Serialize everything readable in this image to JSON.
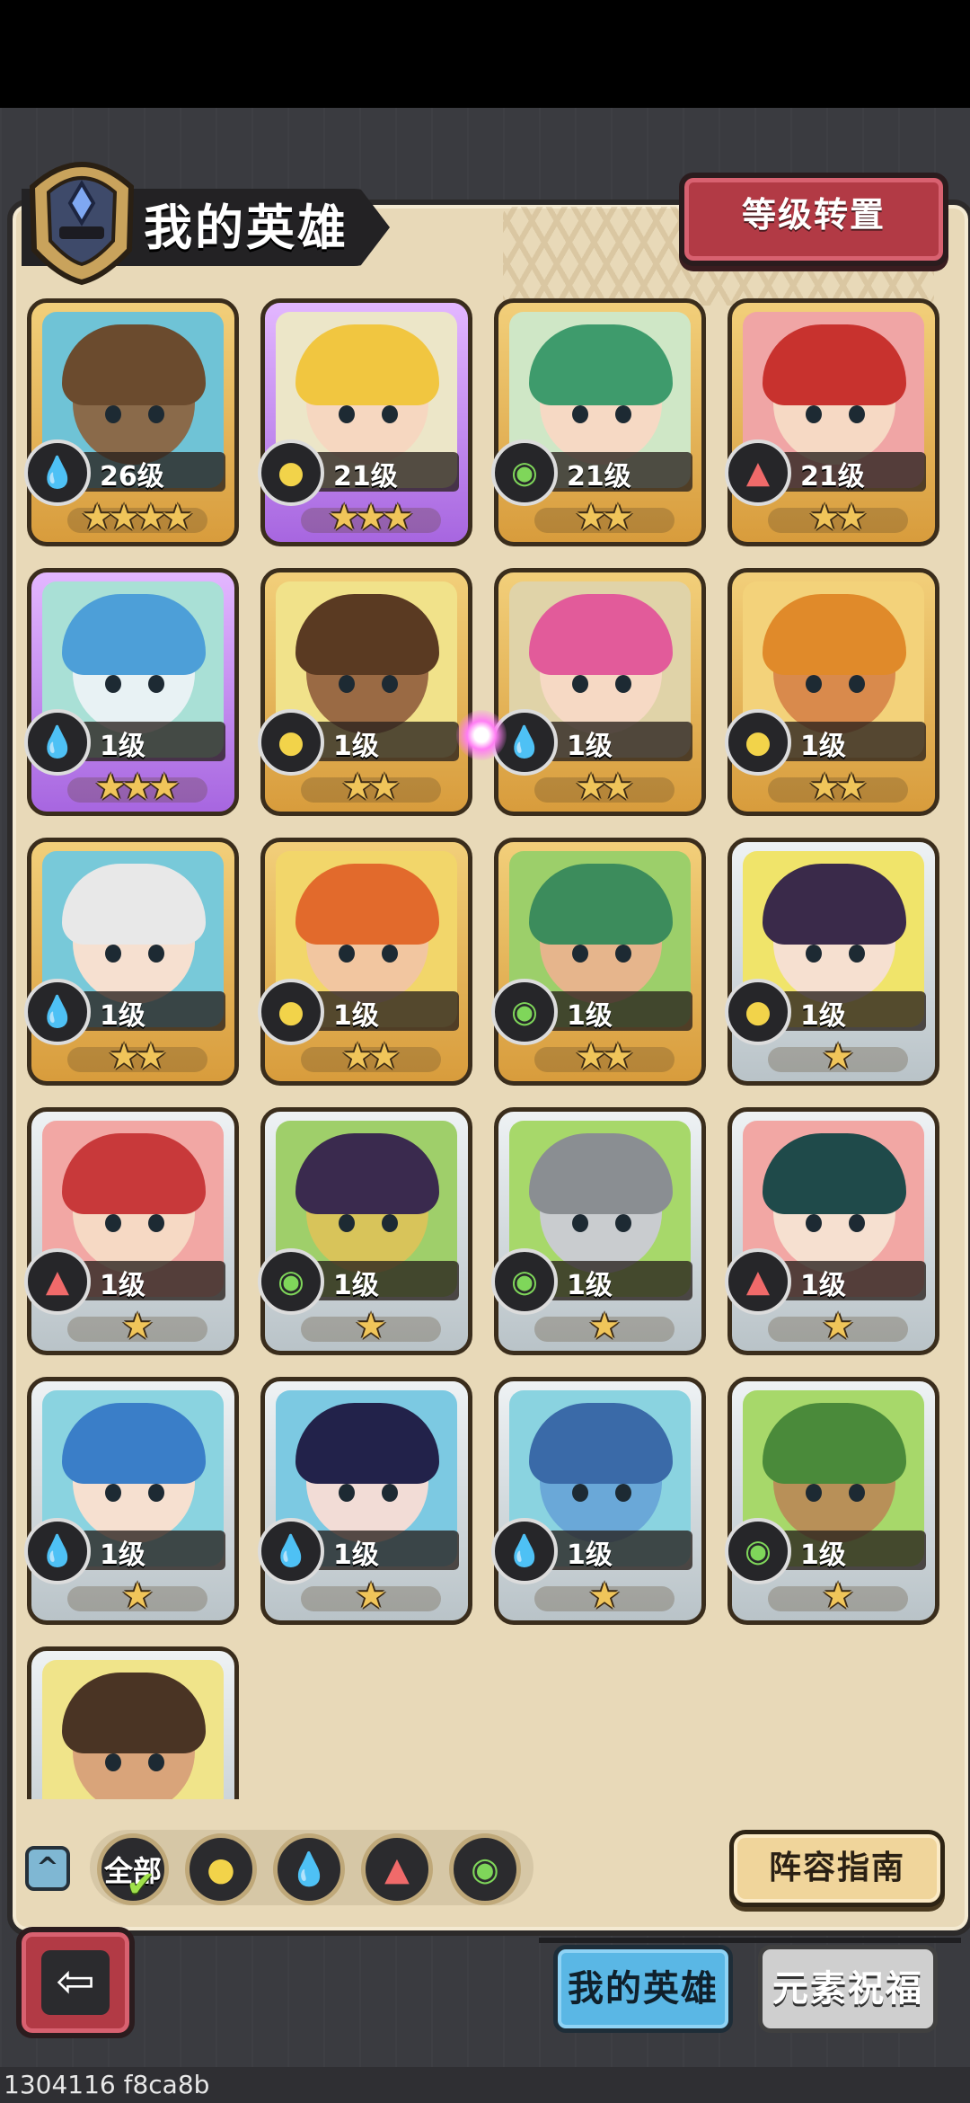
{
  "header": {
    "title": "我的英雄",
    "reset_button_label": "等级转置"
  },
  "heroes": [
    {
      "level": "26级",
      "element": "water",
      "frame": "gold",
      "stars": 4,
      "skin": "#8a6a4a",
      "hair": "#6b4b2e",
      "bg": "#6fc3d6"
    },
    {
      "level": "21级",
      "element": "earth",
      "frame": "purple",
      "stars": 3,
      "skin": "#f6d7c0",
      "hair": "#f1c640",
      "bg": "#ece6c8"
    },
    {
      "level": "21级",
      "element": "wind",
      "frame": "gold",
      "stars": 2,
      "skin": "#f6d9c4",
      "hair": "#3e9b6c",
      "bg": "#cfe7c6"
    },
    {
      "level": "21级",
      "element": "fire",
      "frame": "gold",
      "stars": 2,
      "skin": "#f6d9c4",
      "hair": "#c8322e",
      "bg": "#f0a5a5"
    },
    {
      "level": "1级",
      "element": "water",
      "frame": "purple",
      "stars": 3,
      "skin": "#e8f2f4",
      "hair": "#4d9fd8",
      "bg": "#a9e0d6"
    },
    {
      "level": "1级",
      "element": "earth",
      "frame": "gold",
      "stars": 2,
      "skin": "#9a6a44",
      "hair": "#5a3a22",
      "bg": "#f1e28a"
    },
    {
      "level": "1级",
      "element": "water",
      "frame": "gold",
      "stars": 2,
      "skin": "#f6d9c4",
      "hair": "#e25b9a",
      "bg": "#e0d3a8"
    },
    {
      "level": "1级",
      "element": "earth",
      "frame": "gold",
      "stars": 2,
      "skin": "#d98a4c",
      "hair": "#e08a2a",
      "bg": "#f3d27a"
    },
    {
      "level": "1级",
      "element": "water",
      "frame": "gold",
      "stars": 2,
      "skin": "#f6e0d0",
      "hair": "#e8e8e8",
      "bg": "#78c9d9"
    },
    {
      "level": "1级",
      "element": "earth",
      "frame": "gold",
      "stars": 2,
      "skin": "#f2c6a0",
      "hair": "#e26a2c",
      "bg": "#f2d66a"
    },
    {
      "level": "1级",
      "element": "wind",
      "frame": "gold",
      "stars": 2,
      "skin": "#e6b58c",
      "hair": "#3c8c5c",
      "bg": "#9ccf6a"
    },
    {
      "level": "1级",
      "element": "earth",
      "frame": "silver",
      "stars": 1,
      "skin": "#f6e0d0",
      "hair": "#3a2a4a",
      "bg": "#f0e46a"
    },
    {
      "level": "1级",
      "element": "fire",
      "frame": "silver",
      "stars": 1,
      "skin": "#f6d9c4",
      "hair": "#c8393a",
      "bg": "#f2a7a4"
    },
    {
      "level": "1级",
      "element": "wind",
      "frame": "silver",
      "stars": 1,
      "skin": "#d8c45a",
      "hair": "#3a2a4e",
      "bg": "#9fcf6a"
    },
    {
      "level": "1级",
      "element": "wind",
      "frame": "silver",
      "stars": 1,
      "skin": "#c9cccf",
      "hair": "#8a8e92",
      "bg": "#a7d86a"
    },
    {
      "level": "1级",
      "element": "fire",
      "frame": "silver",
      "stars": 1,
      "skin": "#f6e0d0",
      "hair": "#1f4a4a",
      "bg": "#f2a7a4"
    },
    {
      "level": "1级",
      "element": "water",
      "frame": "silver",
      "stars": 1,
      "skin": "#f6e0d0",
      "hair": "#3a7ec8",
      "bg": "#8ad3e0"
    },
    {
      "level": "1级",
      "element": "water",
      "frame": "silver",
      "stars": 1,
      "skin": "#f2dcd6",
      "hair": "#22224a",
      "bg": "#7cc9e2"
    },
    {
      "level": "1级",
      "element": "water",
      "frame": "silver",
      "stars": 1,
      "skin": "#6aa8d8",
      "hair": "#3a6aa8",
      "bg": "#8ad3e0"
    },
    {
      "level": "1级",
      "element": "wind",
      "frame": "silver",
      "stars": 1,
      "skin": "#b89058",
      "hair": "#4a8a3a",
      "bg": "#a7d86a"
    },
    {
      "level": "",
      "element": "",
      "frame": "silver",
      "stars": 0,
      "skin": "#d9a47a",
      "hair": "#4a3424",
      "bg": "#f0e48a"
    }
  ],
  "filters": {
    "all_label": "全部",
    "elements": [
      "earth",
      "water",
      "fire",
      "wind"
    ],
    "collapse_icon": "chevron-up-icon"
  },
  "guide_button_label": "阵容指南",
  "tabs": {
    "my_heroes": "我的英雄",
    "element_blessing": "元素祝福"
  },
  "build_id": "1304116 f8ca8b",
  "colors": {
    "water": "#58b6e8",
    "earth": "#f2d34a",
    "wind": "#7fd65a",
    "fire": "#f06a6a"
  }
}
